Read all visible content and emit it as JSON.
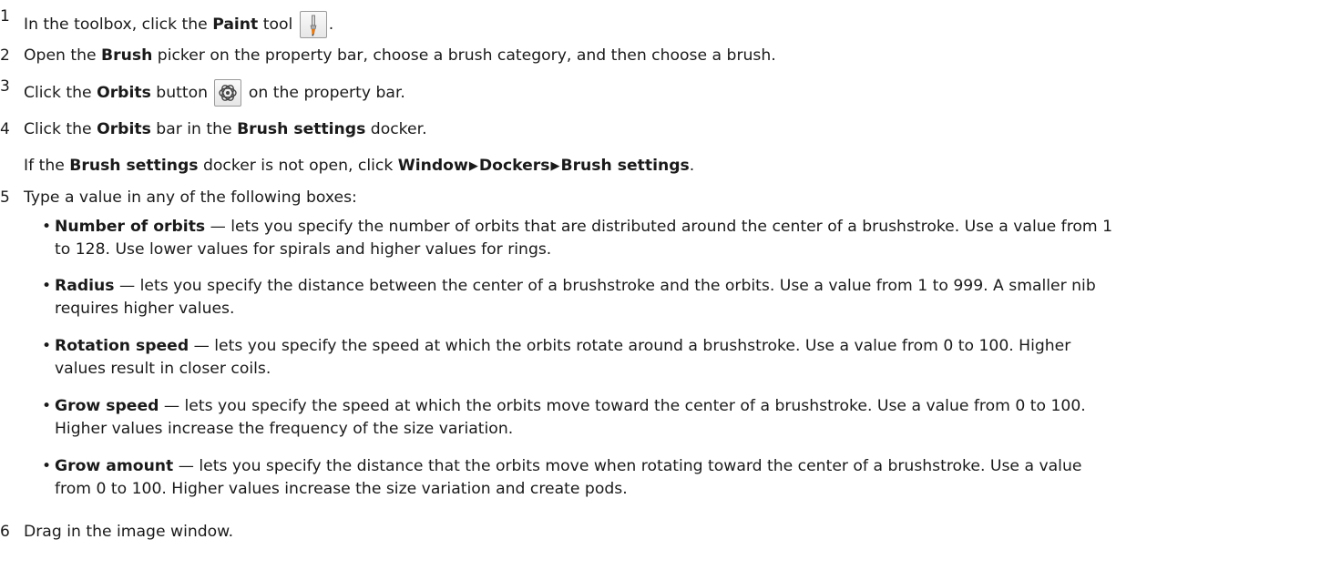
{
  "steps": [
    {
      "num": "1",
      "pre": "In the toolbox, click the ",
      "b1": "Paint",
      "post": " tool",
      "end": "."
    },
    {
      "num": "2",
      "pre": "Open the ",
      "b1": "Brush",
      "post": " picker on the property bar, choose a brush category, and then choose a brush."
    },
    {
      "num": "3",
      "pre": "Click the ",
      "b1": "Orbits",
      "post": " button",
      "post2": " on the property bar."
    },
    {
      "num": "4",
      "pre": "Click the ",
      "b1": "Orbits",
      "mid": " bar in the ",
      "b2": "Brush settings",
      "post": " docker."
    },
    {
      "num": "5",
      "text": "Type a value in any of the following boxes:"
    },
    {
      "num": "6",
      "text": "Drag in the image window."
    }
  ],
  "note": {
    "pre": "If the ",
    "b1": "Brush settings",
    "mid": " docker is not open, click ",
    "menu": [
      "Window",
      "Dockers",
      "Brush settings"
    ],
    "end": "."
  },
  "bullets": [
    {
      "term": "Number of orbits",
      "desc": " — lets you specify the number of orbits that are distributed around the center of a brushstroke. Use a value from 1",
      "desc2": "to 128. Use lower values for spirals and higher values for rings."
    },
    {
      "term": "Radius",
      "desc": " — lets you specify the distance between the center of a brushstroke and the orbits. Use a value from 1 to 999. A smaller nib",
      "desc2": "requires higher values."
    },
    {
      "term": "Rotation speed",
      "desc": " — lets you specify the speed at which the orbits rotate around a brushstroke. Use a value from 0 to 100. Higher",
      "desc2": "values result in closer coils."
    },
    {
      "term": "Grow speed",
      "desc": " — lets you specify the speed at which the orbits move toward the center of a brushstroke. Use a value from 0 to 100.",
      "desc2": "Higher values increase the frequency of the size variation."
    },
    {
      "term": "Grow amount",
      "desc": " — lets you specify the distance that the orbits move when rotating toward the center of a brushstroke. Use a value",
      "desc2": "from 0 to 100. Higher values increase the size variation and create pods."
    }
  ],
  "icons": {
    "paint_tool": "paintbrush-icon",
    "orbits_button": "orbits-icon",
    "menu_separator": "▶"
  }
}
